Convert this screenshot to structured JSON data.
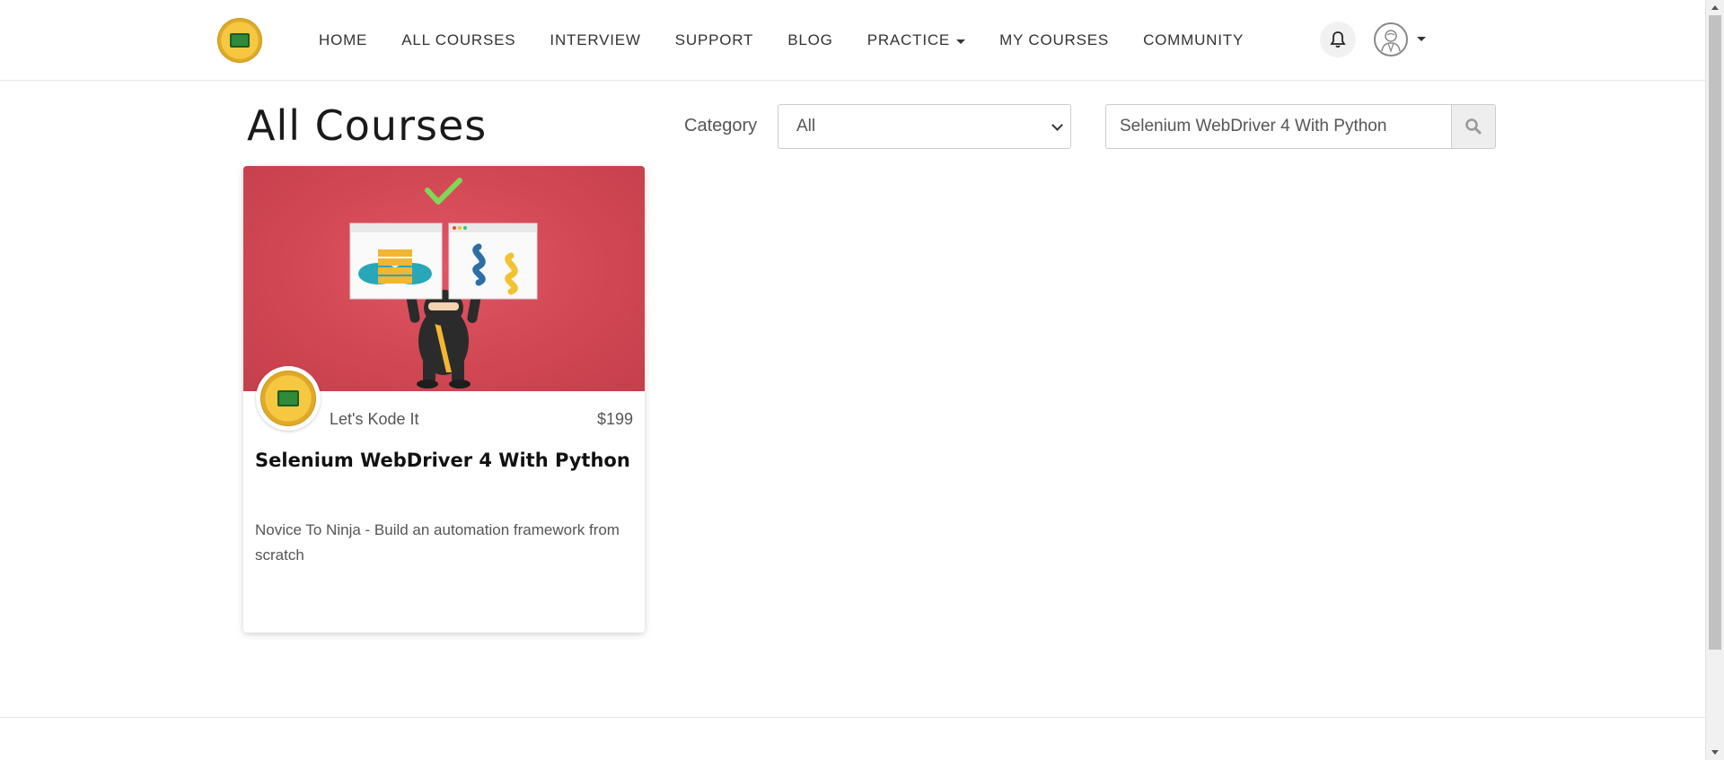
{
  "header": {
    "nav": [
      {
        "label": "HOME"
      },
      {
        "label": "ALL COURSES"
      },
      {
        "label": "INTERVIEW"
      },
      {
        "label": "SUPPORT"
      },
      {
        "label": "BLOG"
      },
      {
        "label": "PRACTICE",
        "has_dropdown": true
      },
      {
        "label": "MY COURSES"
      },
      {
        "label": "COMMUNITY"
      }
    ],
    "icons": {
      "logo": "lets-kode-it-logo",
      "bell": "bell-icon",
      "avatar": "user-avatar-icon"
    }
  },
  "main": {
    "title": "All Courses",
    "filter": {
      "category_label": "Category",
      "category_selected": "All",
      "search_value": "Selenium WebDriver 4 With Python"
    }
  },
  "courses": [
    {
      "author": "Let's Kode It",
      "price": "$199",
      "title": "Selenium WebDriver 4 With Python",
      "subtitle": "Novice To Ninja - Build an automation framework from scratch"
    }
  ],
  "colors": {
    "card_image_bg": "#d24754",
    "accent_check": "#7ed957"
  }
}
